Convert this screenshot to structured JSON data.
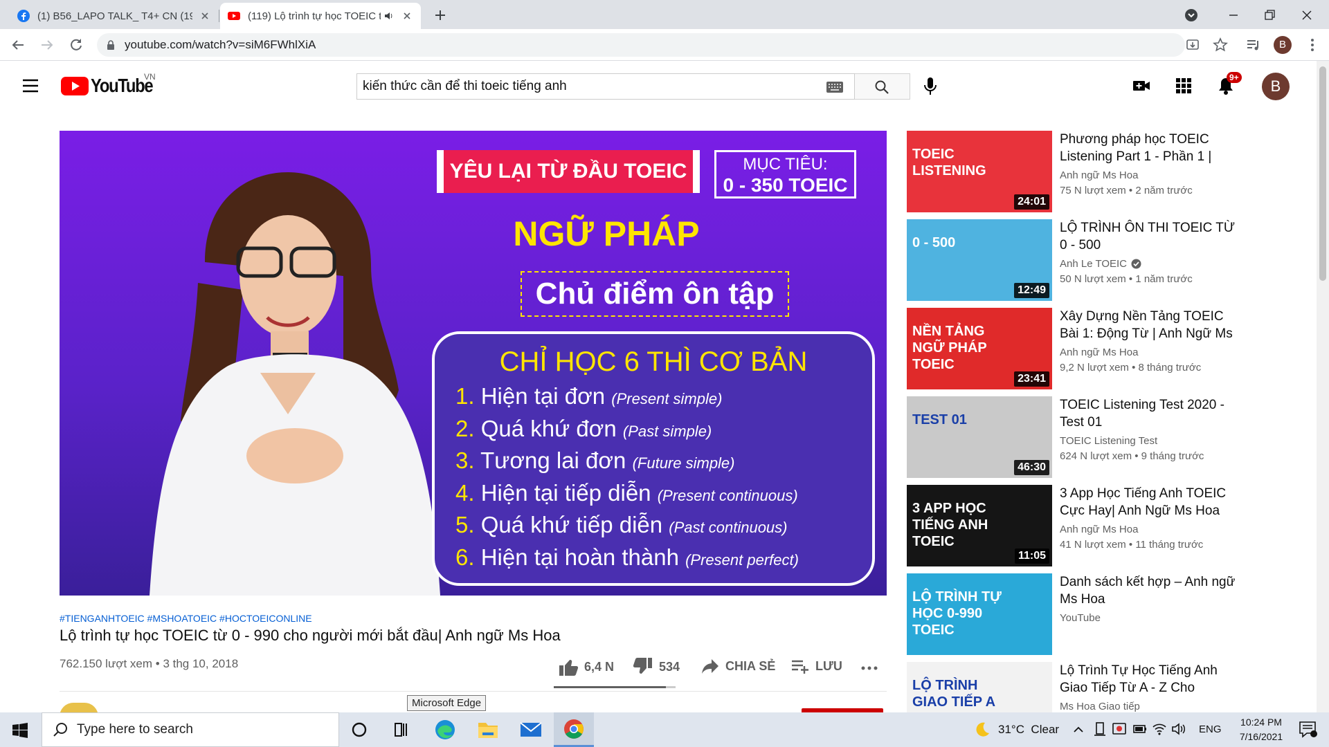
{
  "browser": {
    "tabs": [
      {
        "title": "(1) B56_LAPO TALK_ T4+ CN (19h",
        "favicon": "facebook-icon"
      },
      {
        "title": "(119) Lộ trình tự học TOEIC từ",
        "favicon": "youtube-icon",
        "audio": true
      }
    ],
    "url": "youtube.com/watch?v=siM6FWhlXiA",
    "profile_initial": "B"
  },
  "youtube": {
    "logo_text": "YouTube",
    "region": "VN",
    "search_query": "kiến thức cần để thi toeic tiếng anh",
    "notification_count": "9+",
    "avatar_initial": "B"
  },
  "video": {
    "hashtags": "#TIENGANHTOEIC #MSHOATOEIC #HOCTOEICONLINE",
    "title": "Lộ trình tự học TOEIC từ 0 - 990 cho người mới bắt đầu| Anh ngữ Ms Hoa",
    "meta": "762.150 lượt xem • 3 thg 10, 2018",
    "likes": "6,4 N",
    "dislikes": "534",
    "share_label": "CHIA SẺ",
    "save_label": "LƯU",
    "like_ratio": 0.92,
    "frame": {
      "banner": "YÊU LẠI TỪ ĐẦU TOEIC",
      "target_label": "MỤC TIÊU:",
      "target_value": "0 - 350 TOEIC",
      "heading": "NGỮ PHÁP",
      "subheading": "Chủ điểm ôn tập",
      "box_title": "CHỈ HỌC 6 THÌ CƠ BẢN",
      "tenses": [
        {
          "num": "1.",
          "vi": "Hiện tại đơn",
          "en": "(Present simple)"
        },
        {
          "num": "2.",
          "vi": "Quá khứ đơn",
          "en": "(Past simple)"
        },
        {
          "num": "3.",
          "vi": "Tương lai đơn",
          "en": "(Future simple)"
        },
        {
          "num": "4.",
          "vi": "Hiện tại tiếp diễn",
          "en": "(Present continuous)"
        },
        {
          "num": "5.",
          "vi": "Quá khứ tiếp diễn",
          "en": "(Past continuous)"
        },
        {
          "num": "6.",
          "vi": "Hiện tại hoàn thành",
          "en": "(Present perfect)"
        }
      ]
    }
  },
  "suggestions": [
    {
      "title": "Phương pháp học TOEIC Listening Part 1 - Phần 1 | An...",
      "channel": "Anh ngữ Ms Hoa",
      "meta": "75 N lượt xem • 2 năm trước",
      "duration": "24:01",
      "thumb_text": "TOEIC LISTENING",
      "thumb_bg": "#e8333b"
    },
    {
      "title": "LỘ TRÌNH ÔN THI TOEIC TỪ 0 - 500",
      "channel": "Anh Le TOEIC",
      "verified": true,
      "meta": "50 N lượt xem • 1 năm trước",
      "duration": "12:49",
      "thumb_text": "0 - 500",
      "thumb_bg": "#4fb3e0"
    },
    {
      "title": "Xây Dựng Nền Tảng TOEIC Bài 1: Động Từ | Anh Ngữ Ms Hoa",
      "channel": "Anh ngữ Ms Hoa",
      "meta": "9,2 N lượt xem • 8 tháng trước",
      "duration": "23:41",
      "thumb_text": "NỀN TẢNG NGỮ PHÁP TOEIC",
      "thumb_bg": "#e02a2a"
    },
    {
      "title": "TOEIC Listening Test 2020 - Test 01",
      "channel": "TOEIC Listening Test",
      "meta": "624 N lượt xem • 9 tháng trước",
      "duration": "46:30",
      "thumb_text": "TEST 01",
      "thumb_bg": "#c9c9c9"
    },
    {
      "title": "3 App Học Tiếng Anh TOEIC Cực Hay| Anh Ngữ Ms Hoa",
      "channel": "Anh ngữ Ms Hoa",
      "meta": "41 N lượt xem • 11 tháng trước",
      "duration": "11:05",
      "thumb_text": "3 APP HỌC TIẾNG ANH TOEIC",
      "thumb_bg": "#151515"
    },
    {
      "title": "Danh sách kết hợp – Anh ngữ Ms Hoa",
      "channel": "YouTube",
      "meta": "",
      "duration": "",
      "thumb_text": "LỘ TRÌNH TỰ HỌC 0-990 TOEIC",
      "thumb_bg": "#2aa9d8"
    },
    {
      "title": "Lộ Trình Tự Học Tiếng Anh Giao Tiếp Từ A - Z Cho Người...",
      "channel": "Ms Hoa Giao tiếp",
      "meta": "",
      "duration": "",
      "thumb_text": "LỘ TRÌNH GIAO TIẾP A - Z",
      "thumb_bg": "#f2f2f2"
    }
  ],
  "tooltip": "Microsoft Edge",
  "taskbar": {
    "search_placeholder": "Type here to search",
    "weather": "31°C  Clear",
    "lang": "ENG",
    "time": "10:24 PM",
    "date": "7/16/2021"
  }
}
